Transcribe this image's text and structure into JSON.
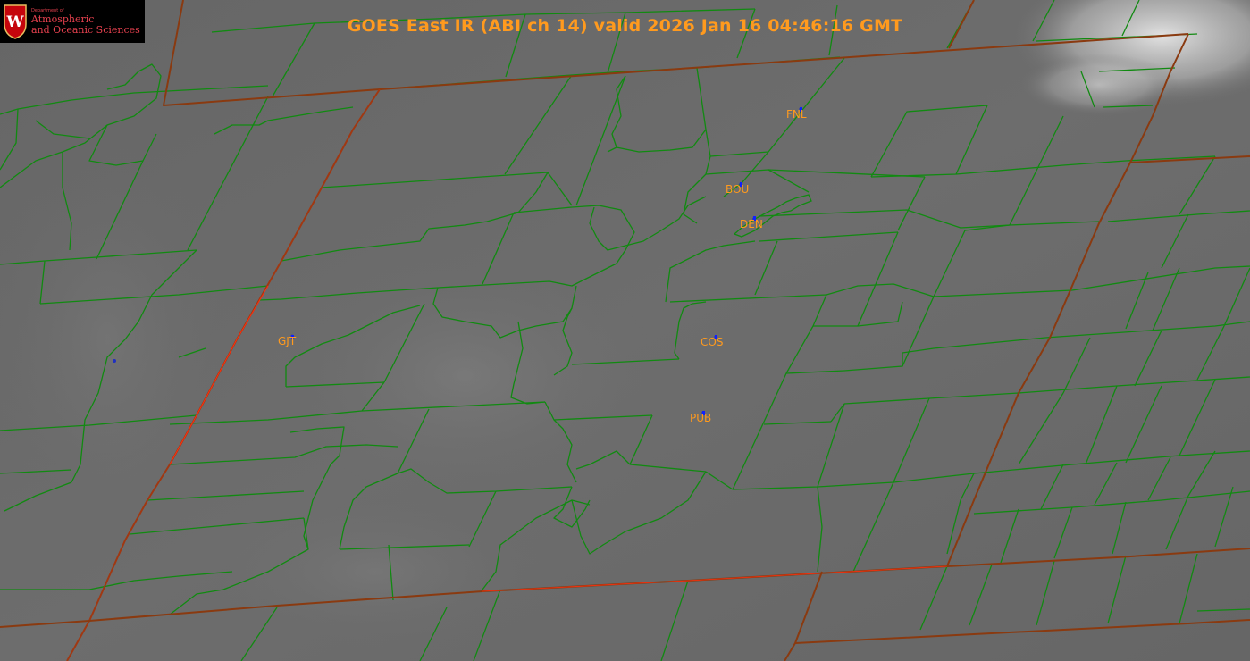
{
  "title": "GOES East IR (ABI ch 14) valid 2026 Jan 16 04:46:16 GMT",
  "logo": {
    "department": "Department of",
    "line1": "Atmospheric",
    "line2": "and Oceanic Sciences",
    "crest_icon": "uw-crest-icon",
    "crest_letter": "W"
  },
  "stations": [
    {
      "id": "FNL",
      "label": "FNL"
    },
    {
      "id": "BOU",
      "label": "BOU"
    },
    {
      "id": "DEN",
      "label": "DEN"
    },
    {
      "id": "GJT",
      "label": "GJT"
    },
    {
      "id": "COS",
      "label": "COS"
    },
    {
      "id": "PUB",
      "label": "PUB"
    }
  ],
  "colors": {
    "state_border": "#8a3a10",
    "state_border_highlight": "#ff3010",
    "county_border": "#118a11",
    "water": "#2030c0",
    "label": "#ff9a1e",
    "marker": "#1020ff",
    "logo_text": "#e8414f"
  }
}
